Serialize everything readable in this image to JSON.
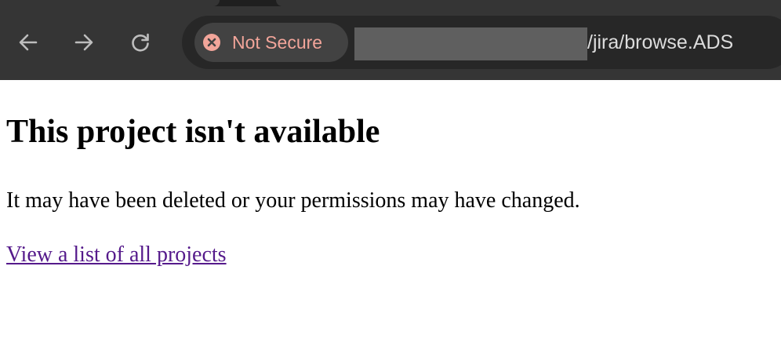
{
  "browser": {
    "nav_icons": {
      "back": "arrow-left-icon",
      "forward": "arrow-right-icon",
      "reload": "reload-icon"
    },
    "security_chip": {
      "icon": "not-secure-x-icon",
      "label": "Not Secure",
      "label_color": "#f2a59a",
      "icon_color": "#f2a59a"
    },
    "url_visible": "/jira/browse.ADS",
    "url_host_redacted": true,
    "chrome_color": "#353535",
    "omnibox_color": "#272727"
  },
  "page": {
    "heading": "This project isn't available",
    "message": "It may have been deleted or your permissions may have changed.",
    "link_label": "View a list of all projects",
    "link_color": "#551a8b"
  }
}
